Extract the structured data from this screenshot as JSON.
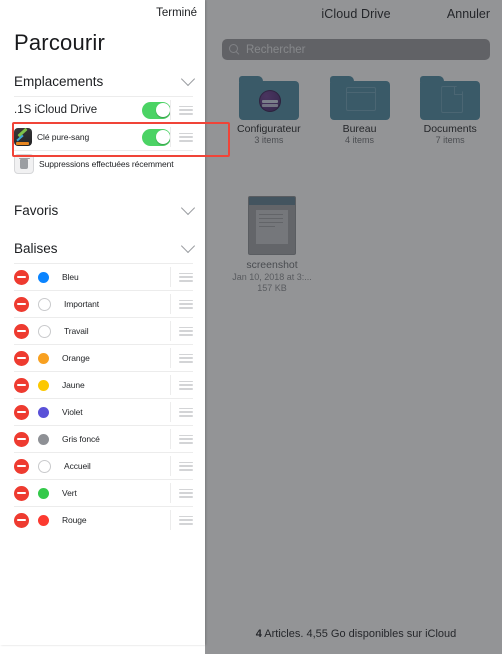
{
  "background_app": {
    "title": "iCloud Drive",
    "cancel_label": "Annuler",
    "search": {
      "placeholder": "Rechercher",
      "icon": "search-icon"
    },
    "items": [
      {
        "name": "Configurateur",
        "subtitle": "3 items",
        "kind": "folder",
        "glyph": "configurator-icon"
      },
      {
        "name": "Bureau",
        "subtitle": "4 items",
        "kind": "folder",
        "glyph": "window-icon"
      },
      {
        "name": "Documents",
        "subtitle": "7 items",
        "kind": "folder",
        "glyph": "document-icon"
      }
    ],
    "file": {
      "name": "screenshot",
      "date": "Jan 10, 2018 at 3:...",
      "size": "157 KB"
    },
    "footer": {
      "count": "4",
      "text": "Articles. 4,55 Go disponibles sur iCloud"
    }
  },
  "panel": {
    "done_label": "Terminé",
    "title": "Parcourir",
    "sections": [
      {
        "id": "locations",
        "label": "Emplacements",
        "chevron": "chevron-down-icon"
      },
      {
        "id": "favorites",
        "label": "Favoris",
        "chevron": "chevron-down-icon"
      },
      {
        "id": "tags",
        "label": "Balises",
        "chevron": "chevron-down-icon"
      }
    ],
    "locations": [
      {
        "label": ".1S iCloud Drive",
        "icon": "icloud-drive-icon",
        "toggle": "on",
        "handle": "drag-handle-icon"
      },
      {
        "label": "Clé pure-sang",
        "icon": "external-drive-icon",
        "toggle": "on",
        "handle": "drag-handle-icon",
        "highlighted": true
      },
      {
        "label": "Suppressions effectuées récemment",
        "icon": "trash-icon",
        "toggle": "none",
        "handle": "none"
      }
    ],
    "tags": [
      {
        "label": "Bleu",
        "color": "#0a84ff",
        "hollow": false
      },
      {
        "label": "Important",
        "color": "",
        "hollow": true
      },
      {
        "label": "Travail",
        "color": "",
        "hollow": true
      },
      {
        "label": "Orange",
        "color": "#f8a020",
        "hollow": false
      },
      {
        "label": "Jaune",
        "color": "#fcc800",
        "hollow": false
      },
      {
        "label": "Violet",
        "color": "#5a51d8",
        "hollow": false
      },
      {
        "label": "Gris foncé",
        "color": "#8e9095",
        "hollow": false
      },
      {
        "label": "Accueil",
        "color": "",
        "hollow": true
      },
      {
        "label": "Vert",
        "color": "#34c94a",
        "hollow": false
      },
      {
        "label": "Rouge",
        "color": "#fc3a30",
        "hollow": false
      }
    ],
    "remove_icon": "minus-circle-icon"
  },
  "annotation": {
    "highlight_color": "#f04438",
    "target": "Clé pure-sang"
  }
}
